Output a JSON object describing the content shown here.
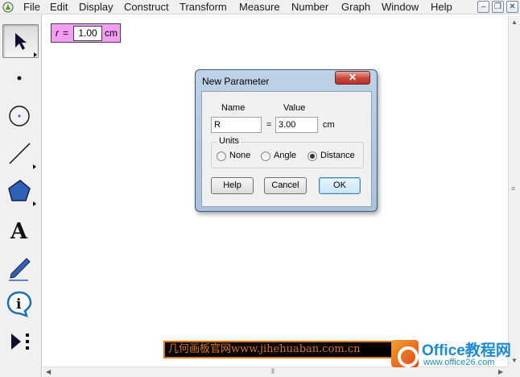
{
  "menubar": {
    "items": [
      "File",
      "Edit",
      "Display",
      "Construct",
      "Transform",
      "Measure",
      "Number",
      "Graph",
      "Window",
      "Help"
    ]
  },
  "tools": [
    "selection-arrow",
    "point",
    "compass",
    "straightedge",
    "polygon",
    "text",
    "marker",
    "information",
    "custom-tools"
  ],
  "parameter": {
    "symbol": "r",
    "equals": "=",
    "value": "1.00",
    "unit": "cm"
  },
  "dialog": {
    "title": "New Parameter",
    "close_label": "✕",
    "name_header": "Name",
    "value_header": "Value",
    "name_value": "R",
    "equals": "=",
    "value_value": "3.00",
    "unit": "cm",
    "units_label": "Units",
    "units_options": [
      "None",
      "Angle",
      "Distance"
    ],
    "selected_unit": "Distance",
    "buttons": {
      "help": "Help",
      "cancel": "Cancel",
      "ok": "OK"
    }
  },
  "watermark1": {
    "text": "几何画板官网www.jihehuaban.com.cn"
  },
  "watermark2": {
    "brand": "Office教程网",
    "url": "www.office26.com"
  },
  "colors": {
    "parameter_bg": "#f49df4",
    "dialog_frame": "#a9c1da",
    "close_button": "#c6463a",
    "watermark_text": "#d77a20",
    "office_blue": "#1d8ad6"
  }
}
